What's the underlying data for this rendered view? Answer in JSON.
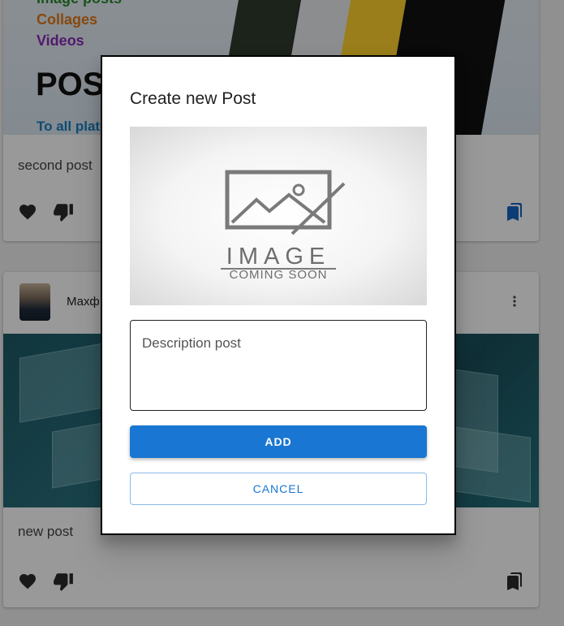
{
  "feed": {
    "post1": {
      "image_text": {
        "line1": "Image posts",
        "line2": "Collages",
        "line3": "Videos",
        "big": "POST",
        "sub": "To all plat"
      },
      "text": "second post"
    },
    "post2": {
      "author": "Махф",
      "text": "new post"
    }
  },
  "icons": {
    "like": "heart-icon",
    "dislike": "thumb-down-icon",
    "bookmark": "bookmark-icon",
    "more": "more-vertical-icon"
  },
  "dialog": {
    "title": "Create new Post",
    "image_placeholder": {
      "line1": "IMAGE",
      "line2": "COMING SOON"
    },
    "description_placeholder": "Description post",
    "add_label": "ADD",
    "cancel_label": "CANCEL"
  },
  "colors": {
    "primary": "#1976d2",
    "icon_dark": "#2b2b2b",
    "bookmark_blue": "#1565c0"
  }
}
